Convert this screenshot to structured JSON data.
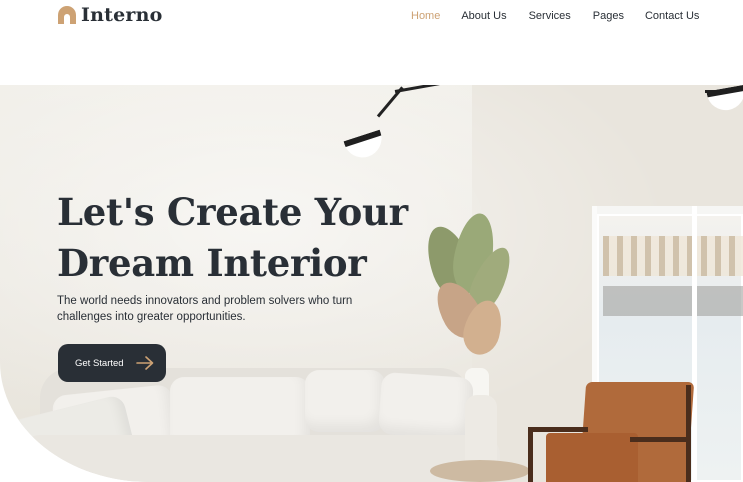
{
  "brand": {
    "name": "Interno",
    "logo_icon": "arch-icon",
    "accent": "#cda274",
    "dark": "#292f36"
  },
  "nav": {
    "items": [
      {
        "label": "Home",
        "active": true
      },
      {
        "label": "About Us",
        "active": false
      },
      {
        "label": "Services",
        "active": false
      },
      {
        "label": "Pages",
        "active": false
      },
      {
        "label": "Contact Us",
        "active": false
      }
    ]
  },
  "hero": {
    "title_line1": "Let's Create Your",
    "title_line2": "Dream Interior",
    "subtitle_line1": "The world needs innovators and problem solvers who turn",
    "subtitle_line2": "challenges into greater opportunities.",
    "cta_label": "Get Started",
    "cta_icon": "arrow-right-icon",
    "image": "living-room-photo"
  }
}
